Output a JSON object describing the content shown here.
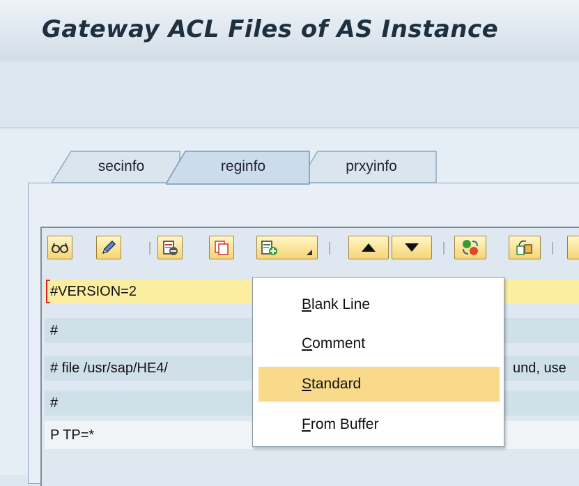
{
  "window": {
    "title": "Gateway ACL Files of AS Instance"
  },
  "tabs": [
    {
      "label": "secinfo",
      "active": false
    },
    {
      "label": "reginfo",
      "active": true
    },
    {
      "label": "prxyinfo",
      "active": false
    }
  ],
  "toolbar": {
    "buttons": [
      {
        "icon": "glasses-icon"
      },
      {
        "icon": "pencil-icon"
      },
      {
        "icon": "delete-row-icon"
      },
      {
        "icon": "copy-row-icon"
      },
      {
        "icon": "insert-row-dropdown-icon"
      },
      {
        "icon": "arrow-up-icon"
      },
      {
        "icon": "arrow-down-icon"
      },
      {
        "icon": "check-syntax-icon"
      },
      {
        "icon": "insert-buffer-icon"
      }
    ]
  },
  "lines": [
    {
      "text": "#VERSION=2",
      "highlight": true
    },
    {
      "text": "#"
    },
    {
      "text": "# file /usr/sap/HE4/",
      "tail": "und, use"
    },
    {
      "text": "#"
    },
    {
      "text": "P TP=*"
    }
  ],
  "menu": {
    "items": [
      {
        "first": "B",
        "rest": "lank Line",
        "selected": false
      },
      {
        "first": "C",
        "rest": "omment",
        "selected": false
      },
      {
        "first": "S",
        "rest": "tandard",
        "selected": true
      },
      {
        "first": "F",
        "rest": "rom Buffer",
        "selected": false
      }
    ]
  },
  "colors": {
    "accent": "#f9d98a",
    "button_fill": "#f6d675",
    "line_highlight": "#fbeea0",
    "line_bg": "#cfe0e8"
  }
}
